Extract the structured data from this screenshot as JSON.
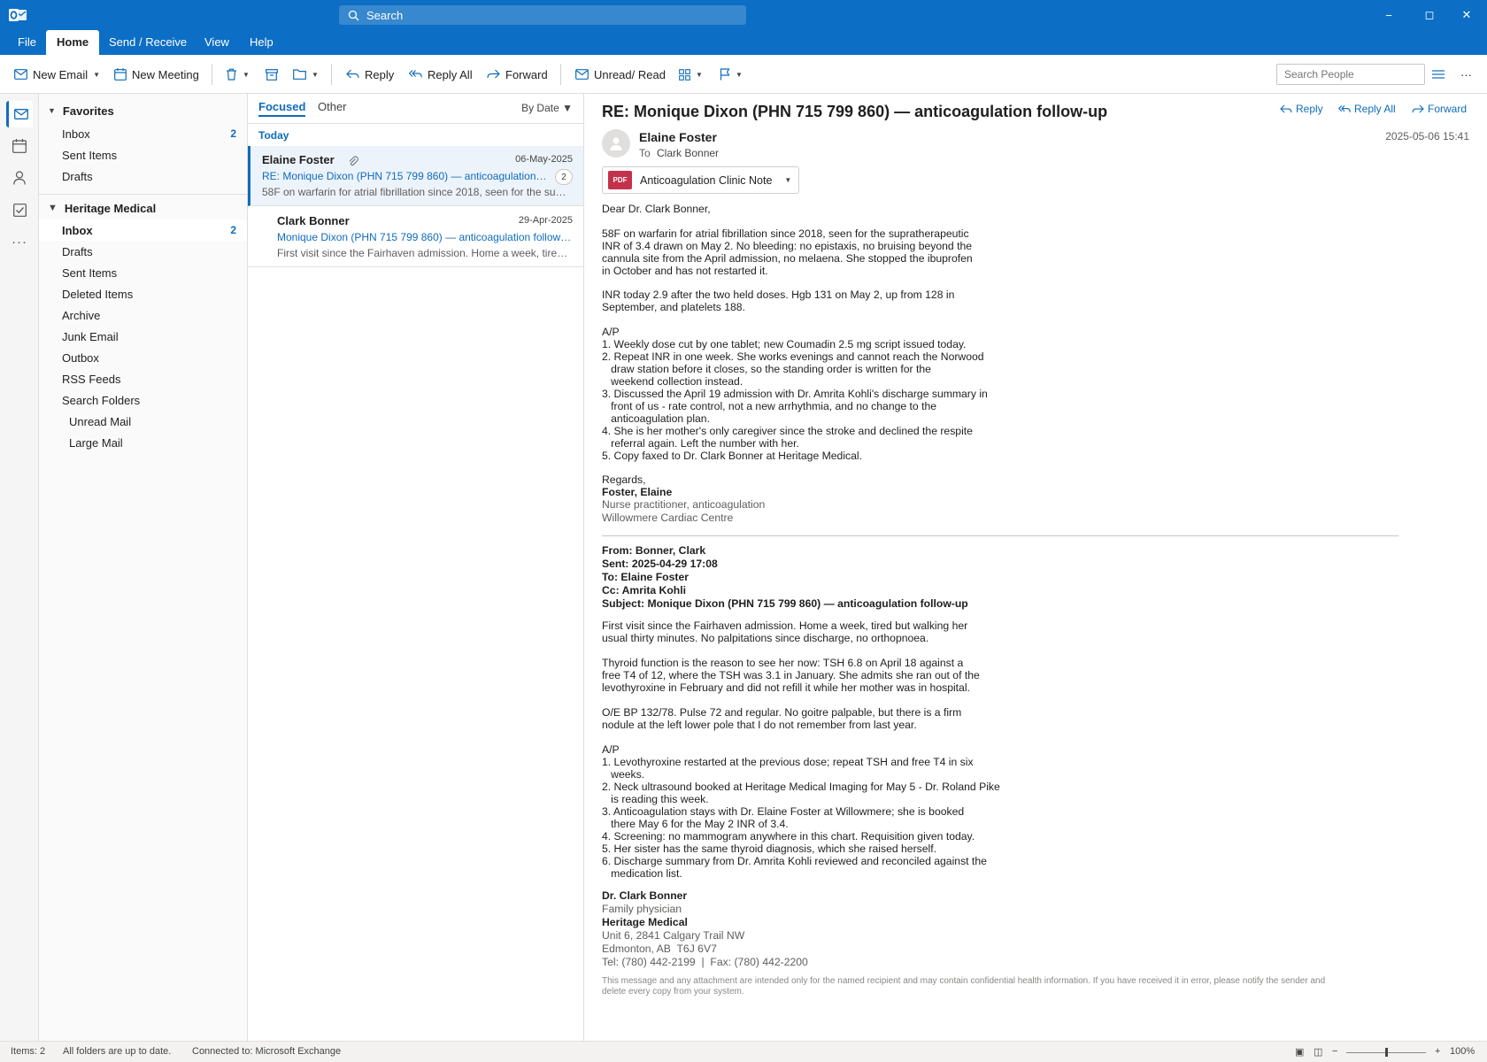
{
  "app": {
    "search_placeholder": "Search",
    "window": {
      "minimize": "−",
      "restore": "◻",
      "close": "✕"
    }
  },
  "menu": {
    "tabs": [
      "File",
      "Home",
      "Send / Receive",
      "View",
      "Help"
    ],
    "active": "Home"
  },
  "toolbar": {
    "new_email": "New Email",
    "new_meeting": "New Meeting",
    "reply": "Reply",
    "reply_all": "Reply All",
    "forward": "Forward",
    "unread_read": "Unread/ Read",
    "search_people_placeholder": "Search People",
    "more": "···"
  },
  "folders": {
    "favorites": {
      "title": "Favorites",
      "items": [
        {
          "label": "Inbox",
          "count": "2"
        },
        {
          "label": "Sent Items",
          "count": ""
        },
        {
          "label": "Drafts",
          "count": ""
        }
      ]
    },
    "account": {
      "title": "Heritage Medical",
      "items": [
        {
          "label": "Inbox",
          "count": "2"
        },
        {
          "label": "Drafts",
          "count": ""
        },
        {
          "label": "Sent Items",
          "count": ""
        },
        {
          "label": "Deleted Items",
          "count": ""
        },
        {
          "label": "Archive",
          "count": ""
        },
        {
          "label": "Junk Email",
          "count": ""
        },
        {
          "label": "Outbox",
          "count": ""
        },
        {
          "label": "RSS Feeds",
          "count": ""
        },
        {
          "label": "Search Folders",
          "count": ""
        },
        {
          "label": "Unread Mail",
          "count": ""
        },
        {
          "label": "Large Mail",
          "count": ""
        }
      ]
    }
  },
  "message_list": {
    "tabs": [
      "Focused",
      "Other"
    ],
    "sort": "By Date ▼",
    "group": "Today",
    "messages": [
      {
        "from": "Elaine Foster",
        "date": "06-May-2025",
        "subject": "RE: Monique Dixon (PHN 715 799 860) — anticoagulation follow-up",
        "preview": "58F on warfarin for atrial fibrillation since 2018, seen for the supratherapeutic INR",
        "count": "2"
      },
      {
        "from": "Clark Bonner",
        "date": "29-Apr-2025",
        "subject": "Monique Dixon (PHN 715 799 860) — anticoagulation follow-up",
        "preview": "First visit since the Fairhaven admission. Home a week, tired but walking her usual"
      }
    ]
  },
  "reading": {
    "subject": "RE: Monique Dixon (PHN 715 799 860) — anticoagulation follow-up",
    "actions": {
      "reply": "Reply",
      "reply_all": "Reply All",
      "forward": "Forward"
    },
    "from": "Elaine Foster",
    "to_label": "To",
    "to": "Clark Bonner",
    "date": "2025-05-06 15:41",
    "attachment": {
      "type": "PDF",
      "name": "Anticoagulation Clinic Note"
    },
    "greeting": "Dear Dr. Clark Bonner,",
    "para1": "58F on warfarin for atrial fibrillation since 2018, seen for the supratherapeutic\nINR of 3.4 drawn on May 2. No bleeding: no epistaxis, no bruising beyond the\ncannula site from the April admission, no melaena. She stopped the ibuprofen\nin October and has not restarted it.",
    "para2": "INR today 2.9 after the two held doses. Hgb 131 on May 2, up from 128 in\nSeptember, and platelets 188.",
    "plan": "A/P\n1. Weekly dose cut by one tablet; new Coumadin 2.5 mg script issued today.\n2. Repeat INR in one week. She works evenings and cannot reach the Norwood\n   draw station before it closes, so the standing order is written for the\n   weekend collection instead.\n3. Discussed the April 19 admission with Dr. Amrita Kohli's discharge summary in\n   front of us - rate control, not a new arrhythmia, and no change to the\n   anticoagulation plan.\n4. She is her mother's only caregiver since the stroke and declined the respite\n   referral again. Left the number with her.\n5. Copy faxed to Dr. Clark Bonner at Heritage Medical.",
    "regards": "Regards,",
    "sig_name": "Foster, Elaine",
    "sig_title": "Nurse practitioner, anticoagulation",
    "sig_org": "Willowmere Cardiac Centre",
    "quoted": {
      "from": "From: Bonner, Clark",
      "sent": "Sent: 2025-04-29 17:08",
      "to": "To: Elaine Foster",
      "cc": "Cc: Amrita Kohli",
      "subject": "Subject: Monique Dixon (PHN 715 799 860) — anticoagulation follow-up",
      "para1": "First visit since the Fairhaven admission. Home a week, tired but walking her\nusual thirty minutes. No palpitations since discharge, no orthopnoea.",
      "para2": "Thyroid function is the reason to see her now: TSH 6.8 on April 18 against a\nfree T4 of 12, where the TSH was 3.1 in January. She admits she ran out of the\nlevothyroxine in February and did not refill it while her mother was in hospital.",
      "para3": "O/E BP 132/78. Pulse 72 and regular. No goitre palpable, but there is a firm\nnodule at the left lower pole that I do not remember from last year.",
      "plan": "A/P\n1. Levothyroxine restarted at the previous dose; repeat TSH and free T4 in six\n   weeks.\n2. Neck ultrasound booked at Heritage Medical Imaging for May 5 - Dr. Roland Pike\n   is reading this week.\n3. Anticoagulation stays with Dr. Elaine Foster at Willowmere; she is booked\n   there May 6 for the May 2 INR of 3.4.\n4. Screening: no mammogram anywhere in this chart. Requisition given today.\n5. Her sister has the same thyroid diagnosis, which she raised herself.\n6. Discharge summary from Dr. Amrita Kohli reviewed and reconciled against the\n   medication list.",
      "sig_name": "Dr. Clark Bonner",
      "sig_title": "Family physician",
      "sig_org": "Heritage Medical",
      "sig_addr1": "Unit 6, 2841 Calgary Trail NW",
      "sig_addr2": "Edmonton, AB  T6J 6V7",
      "sig_phone": "Tel: (780) 442-2199  |  Fax: (780) 442-2200",
      "disclaimer": "This message and any attachment are intended only for the named recipient and may contain confidential health information. If you have received it in error, please notify the sender and delete every copy from your system."
    }
  },
  "status": {
    "items": "Items: 2",
    "sync": "All folders are up to date.",
    "connection": "Connected to: Microsoft Exchange",
    "zoom_minus": "−",
    "zoom_plus": "+",
    "zoom": "100%"
  },
  "colors": {
    "brand": "#0c6ec4",
    "accent": "#0f6cbd",
    "pdf": "#c4314b"
  }
}
